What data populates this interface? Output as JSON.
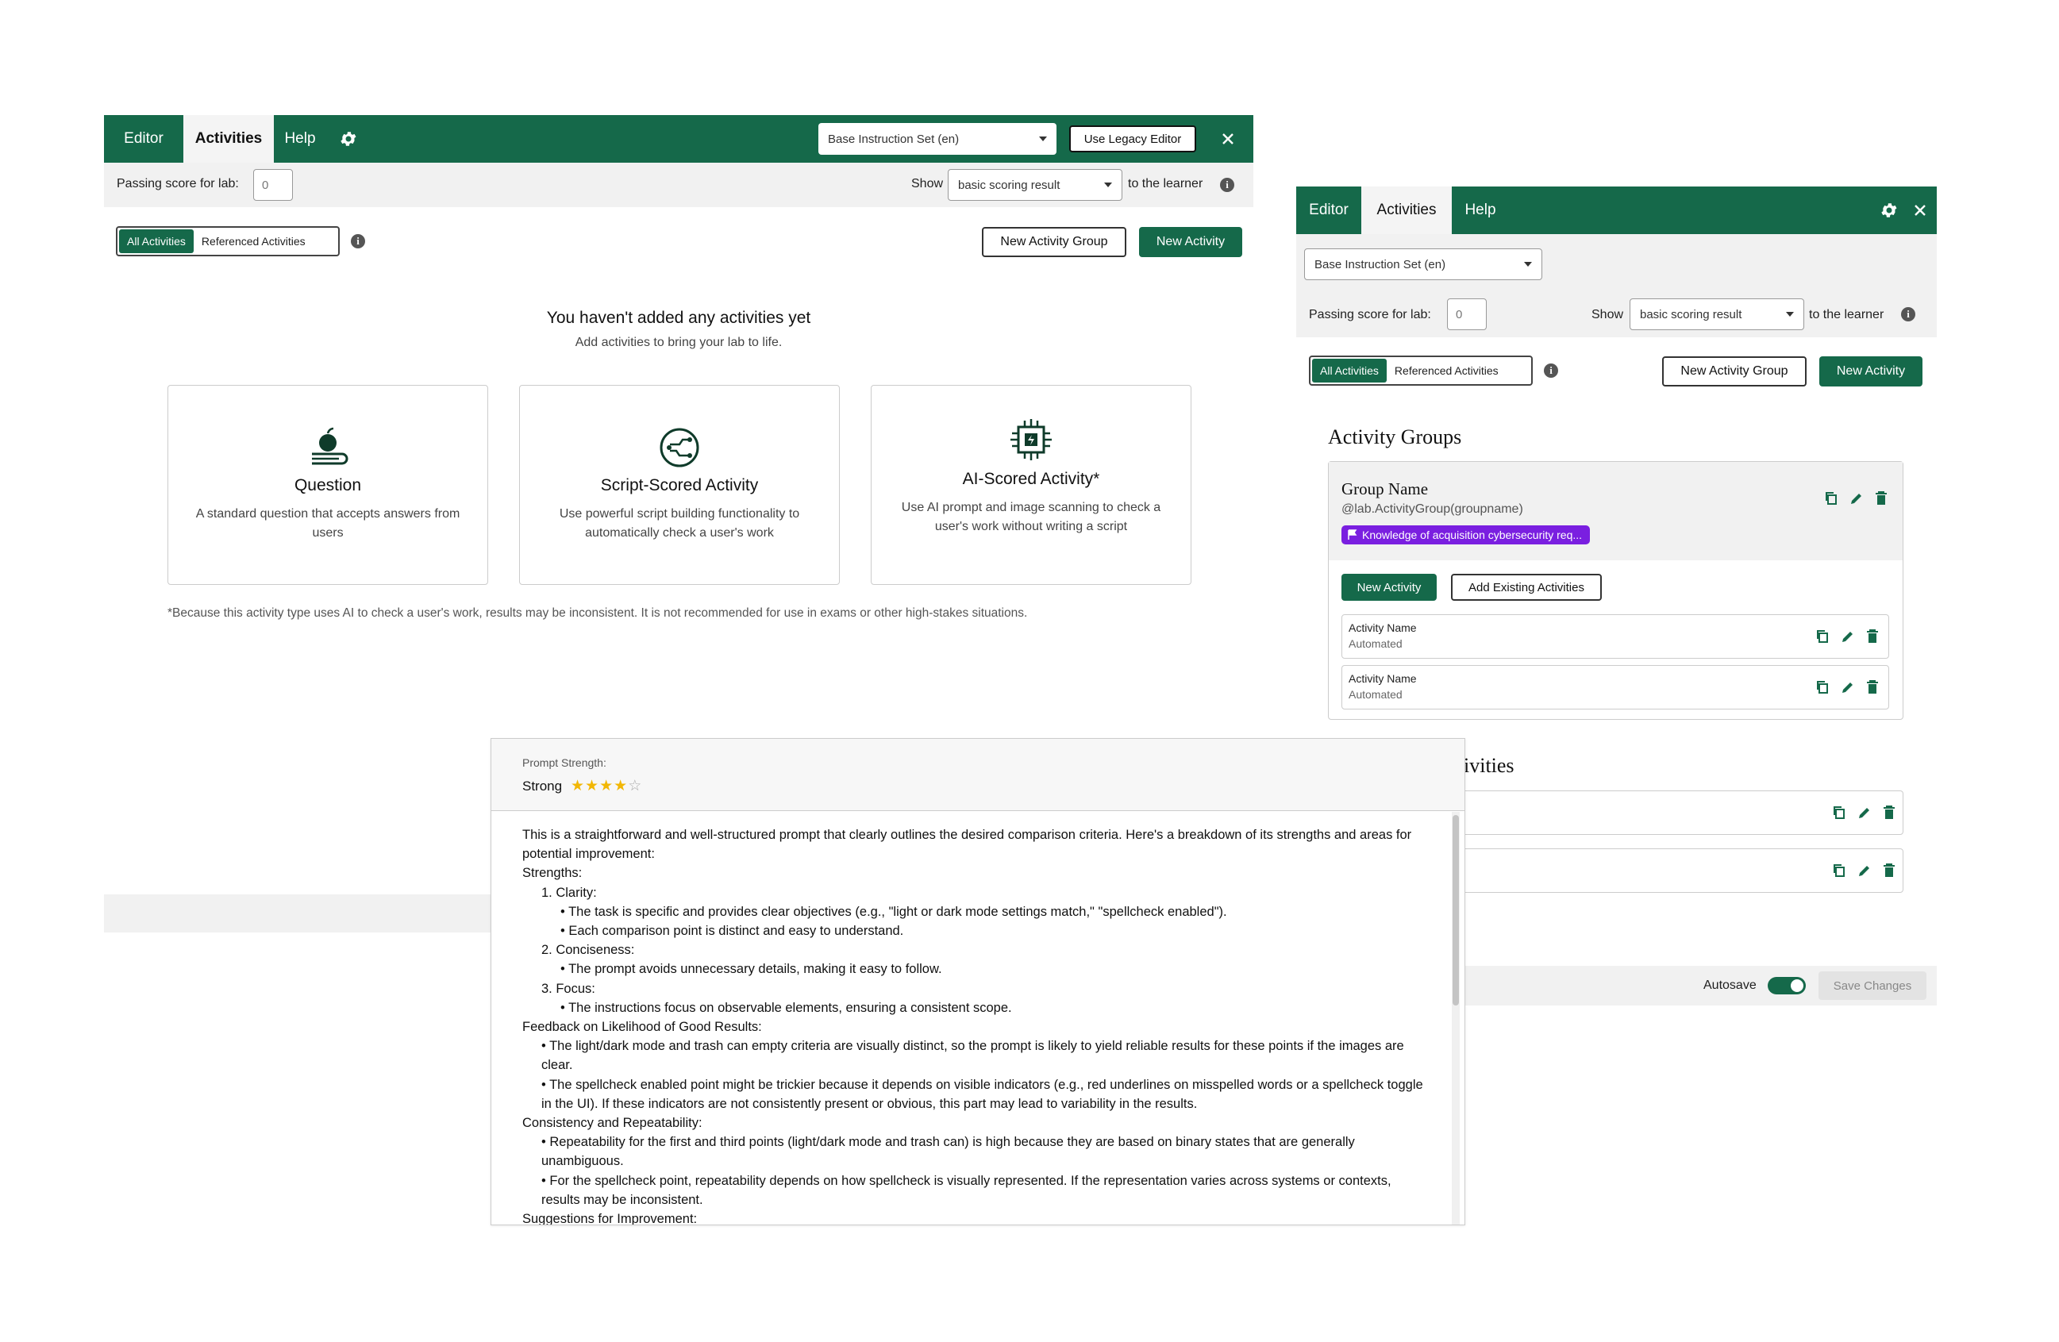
{
  "panel1": {
    "tabs": [
      "Editor",
      "Activities",
      "Help"
    ],
    "instruction_set": "Base Instruction Set (en)",
    "legacy_button": "Use Legacy Editor",
    "passing_label": "Passing score for lab:",
    "passing_value": "0",
    "show_label": "Show",
    "show_select": "basic scoring result",
    "to_learner": "to the learner",
    "seg_all": "All Activities",
    "seg_ref": "Referenced Activities",
    "new_group": "New Activity Group",
    "new_activity": "New Activity",
    "empty_title": "You haven't added any activities yet",
    "empty_sub": "Add activities to bring your lab to life.",
    "cards": [
      {
        "title": "Question",
        "desc": "A standard question that accepts answers from users",
        "icon": "question-apple-book-icon"
      },
      {
        "title": "Script-Scored Activity",
        "desc": "Use powerful script building functionality to automatically check a user's work",
        "icon": "script-circuit-icon"
      },
      {
        "title": "AI-Scored Activity*",
        "desc": "Use AI prompt and image scanning to check a user's work without writing a script",
        "icon": "ai-chip-icon"
      }
    ],
    "footnote": "*Because this activity type uses AI to check a user's work, results may be inconsistent. It is not recommended for use in exams or other high-stakes situations."
  },
  "panel2": {
    "tabs": [
      "Editor",
      "Activities",
      "Help"
    ],
    "instruction_set": "Base Instruction Set (en)",
    "passing_label": "Passing score for lab:",
    "passing_value": "0",
    "show_label": "Show",
    "show_select": "basic scoring result",
    "to_learner": "to the learner",
    "seg_all": "All Activities",
    "seg_ref": "Referenced Activities",
    "new_group": "New Activity Group",
    "new_activity": "New Activity",
    "groups_heading": "Activity Groups",
    "group_name": "Group Name",
    "group_ref": "@lab.ActivityGroup(groupname)",
    "group_tag": "Knowledge of acquisition cybersecurity req...",
    "group_new_activity": "New Activity",
    "group_add_existing": "Add Existing Activities",
    "activities": [
      {
        "name": "Activity Name",
        "type": "Automated"
      },
      {
        "name": "Activity Name",
        "type": "Automated"
      }
    ],
    "activities_heading_partial": "ivities",
    "autosave_label": "Autosave",
    "save_changes": "Save Changes"
  },
  "prompt_panel": {
    "strength_label": "Prompt Strength:",
    "strength_value": "Strong",
    "stars_filled": 4,
    "stars_total": 5,
    "lines": [
      {
        "indent": 0,
        "text": "This is a straightforward and well-structured prompt that clearly outlines the desired comparison criteria. Here's a breakdown of its strengths and areas for potential improvement:"
      },
      {
        "indent": 0,
        "text": "Strengths:"
      },
      {
        "indent": 1,
        "text": "1. Clarity:"
      },
      {
        "indent": 2,
        "text": "• The task is specific and provides clear objectives (e.g., \"light or dark mode settings match,\" \"spellcheck enabled\")."
      },
      {
        "indent": 2,
        "text": "• Each comparison point is distinct and easy to understand."
      },
      {
        "indent": 1,
        "text": "2. Conciseness:"
      },
      {
        "indent": 2,
        "text": "• The prompt avoids unnecessary details, making it easy to follow."
      },
      {
        "indent": 1,
        "text": "3. Focus:"
      },
      {
        "indent": 2,
        "text": "• The instructions focus on observable elements, ensuring a consistent scope."
      },
      {
        "indent": 0,
        "text": "Feedback on Likelihood of Good Results:"
      },
      {
        "indent": 1,
        "text": "• The light/dark mode and trash can empty criteria are visually distinct, so the prompt is likely to yield reliable results for these points if the images are clear."
      },
      {
        "indent": 1,
        "text": "• The spellcheck enabled point might be trickier because it depends on visible indicators (e.g., red underlines on misspelled words or a spellcheck toggle in the UI). If these indicators are not consistently present or obvious, this part may lead to variability in the results."
      },
      {
        "indent": 0,
        "text": "Consistency and Repeatability:"
      },
      {
        "indent": 1,
        "text": "• Repeatability for the first and third points (light/dark mode and trash can) is high because they are based on binary states that are generally unambiguous."
      },
      {
        "indent": 1,
        "text": "• For the spellcheck point, repeatability depends on how spellcheck is visually represented. If the representation varies across systems or contexts, results may be inconsistent."
      },
      {
        "indent": 0,
        "text": "Suggestions for Improvement:"
      }
    ]
  },
  "colors": {
    "brand_green": "#15694a",
    "tag_purple": "#7a1fe0",
    "star": "#f2b705"
  }
}
